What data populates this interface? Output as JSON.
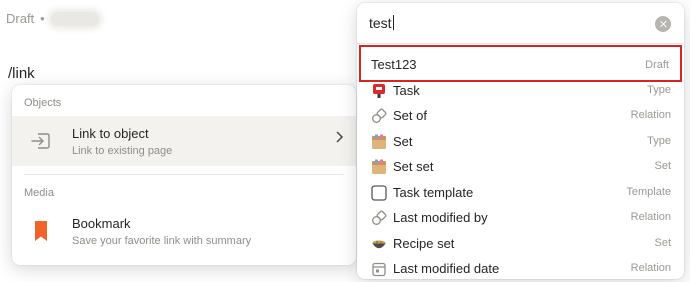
{
  "editor": {
    "status": "Draft",
    "separator": "•",
    "slash_command": "/link"
  },
  "slash_menu": {
    "sections": [
      {
        "title": "Objects",
        "items": [
          {
            "title": "Link to object",
            "subtitle": "Link to existing page",
            "icon": "link-arrow-icon"
          }
        ]
      },
      {
        "title": "Media",
        "items": [
          {
            "title": "Bookmark",
            "subtitle": "Save your favorite link with summary",
            "icon": "bookmark-icon"
          }
        ]
      }
    ]
  },
  "search": {
    "query": "test",
    "results": [
      {
        "name": "Test123",
        "type": "Draft",
        "icon": "none"
      },
      {
        "name": "Task",
        "type": "Type",
        "icon": "task-stamp-icon"
      },
      {
        "name": "Set of",
        "type": "Relation",
        "icon": "relation-icon"
      },
      {
        "name": "Set",
        "type": "Type",
        "icon": "set-box-icon"
      },
      {
        "name": "Set set",
        "type": "Set",
        "icon": "set-box-icon"
      },
      {
        "name": "Task template",
        "type": "Template",
        "icon": "checkbox-icon"
      },
      {
        "name": "Last modified by",
        "type": "Relation",
        "icon": "relation-icon"
      },
      {
        "name": "Recipe set",
        "type": "Set",
        "icon": "bowl-icon"
      },
      {
        "name": "Last modified date",
        "type": "Relation",
        "icon": "calendar-icon"
      }
    ]
  },
  "colors": {
    "highlight_border": "#d72323",
    "bookmark": "#f0642a",
    "task_icon": "#d92b2b",
    "set_box": "#e0b37a"
  }
}
